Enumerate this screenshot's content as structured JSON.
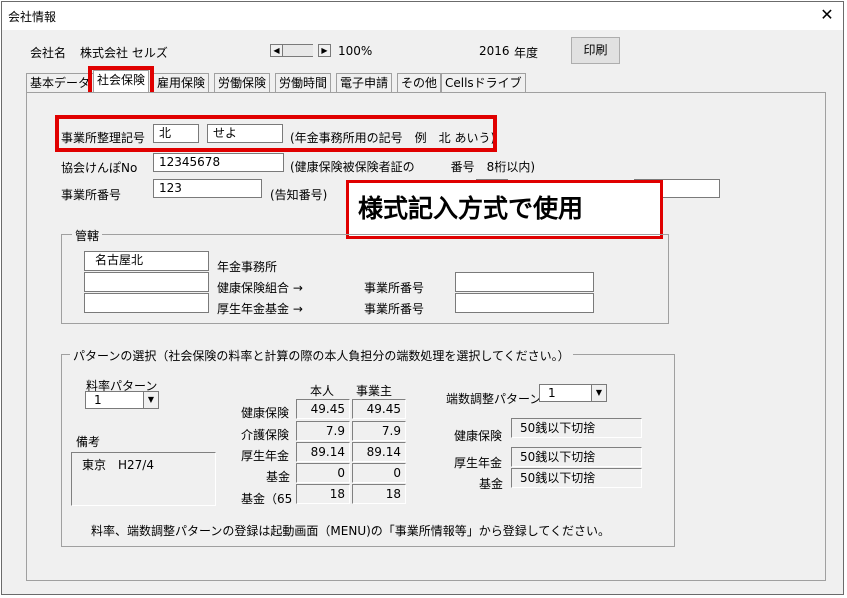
{
  "window": {
    "title": "会社情報",
    "close_glyph": "✕"
  },
  "header": {
    "company_label": "会社名",
    "company_name": "株式会社 セルズ",
    "spin_left": "◀",
    "spin_right": "▶",
    "zoom": "100%",
    "year_value": "2016",
    "year_label": "年度",
    "print_label": "印刷"
  },
  "tabs": [
    "基本データ",
    "社会保険",
    "雇用保険",
    "労働保険",
    "労働時間",
    "電子申請",
    "その他",
    "Cellsドライブ"
  ],
  "office": {
    "code_label": "事業所整理記号",
    "code_part1": "北",
    "code_part2": "せよ",
    "code_note": "(年金事務所用の記号　例　北 あいう)",
    "kyokai_label": "協会けんぽNo",
    "kyokai_value": "12345678",
    "kyokai_note": "(健康保険被保険者証の　　　番号　8桁以内)",
    "office_no_label": "事業所番号",
    "office_no_value": "123",
    "office_no_note": "(告知番号)"
  },
  "callout": {
    "text": "様式記入方式で使用"
  },
  "jurisdiction": {
    "title": "管轄",
    "pension_office_value": "名古屋北",
    "pension_office_label": "年金事務所",
    "health_assoc_label": "健康保険組合 →",
    "pension_fund_label": "厚生年金基金 →",
    "office_no_label1": "事業所番号",
    "office_no_label2": "事業所番号"
  },
  "pattern": {
    "title": "パターンの選択（社会保険の料率と計算の際の本人負担分の端数処理を選択してください。）",
    "rate_pattern_label": "料率パターン",
    "rate_pattern_value": "1",
    "col_self": "本人",
    "col_employer": "事業主",
    "rows": [
      {
        "label": "健康保険",
        "self": "49.45",
        "employer": "49.45"
      },
      {
        "label": "介護保険",
        "self": "7.9",
        "employer": "7.9"
      },
      {
        "label": "厚生年金",
        "self": "89.14",
        "employer": "89.14"
      },
      {
        "label": "基金",
        "self": "0",
        "employer": "0"
      },
      {
        "label": "基金（65",
        "self": "18",
        "employer": "18"
      }
    ],
    "remarks_label": "備考",
    "remarks_value": "東京　H27/4",
    "rounding_label": "端数調整パターン",
    "rounding_value": "1",
    "rounding_rows": [
      {
        "label": "健康保険",
        "value": "50銭以下切捨"
      },
      {
        "label": "厚生年金",
        "value": "50銭以下切捨"
      },
      {
        "label": "基金",
        "value": "50銭以下切捨"
      }
    ],
    "footnote": "料率、端数調整パターンの登録は起動画面（MENU)の「事業所情報等」から登録してください。"
  }
}
